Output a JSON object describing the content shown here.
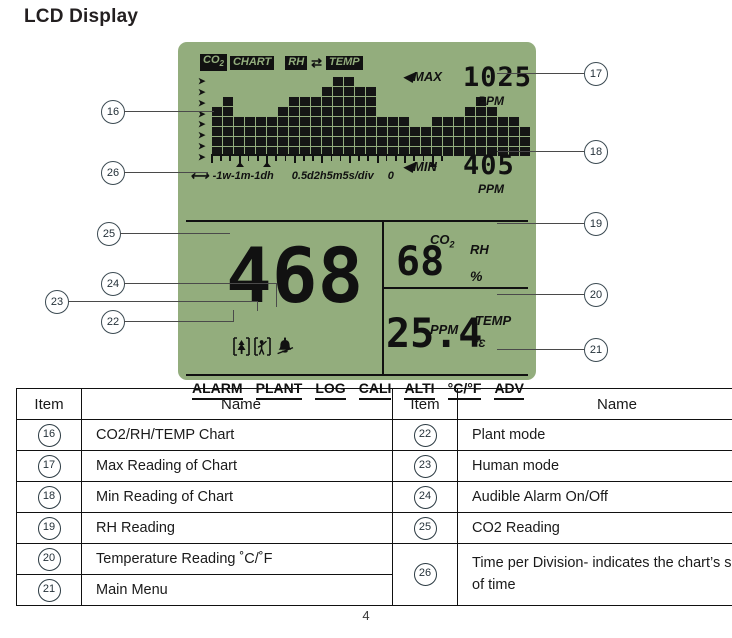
{
  "page_title": "LCD Display",
  "page_number": "4",
  "lcd": {
    "background_color": "#93ad7d",
    "segment_labels": {
      "co2": "CO2",
      "co2_main": "CO",
      "co2_sub": "2",
      "chart": "CHART",
      "rh": "RH",
      "swap_icon": "⇄",
      "temp": "TEMP"
    },
    "max": {
      "label": "MAX",
      "value": "1025",
      "unit": "PPM",
      "arrow": "←"
    },
    "min": {
      "label": "MIN",
      "value": "405",
      "unit": "PPM",
      "arrow": "←"
    },
    "time_axis": {
      "arrow_icon": "⟷",
      "left_labels": "-1w-1m-1dh",
      "right_labels": "0.5d2h5m5s/div",
      "zero": "0"
    },
    "main_reading": {
      "label_main": "CO",
      "label_sub": "2",
      "value": "468",
      "unit": "PPM"
    },
    "mode_icons": {
      "plant": "plant-mode-icon",
      "human": "human-mode-icon",
      "bell": "audible-alarm-icon"
    },
    "humidity": {
      "value": "68",
      "label": "RH",
      "unit": "%"
    },
    "temperature": {
      "value": "25.4",
      "label": "TEMP",
      "unit": "°Ɛ"
    },
    "menu_items": [
      "ALARM",
      "PLANT",
      "LOG",
      "CALI",
      "ALTI",
      "°C/°F",
      "ADV"
    ]
  },
  "chart_data": {
    "type": "bar",
    "title": "CO2/RH/TEMP Chart",
    "xlabel": "Time per division",
    "ylabel": "",
    "values": [
      5,
      6,
      4,
      4,
      4,
      4,
      5,
      6,
      6,
      6,
      7,
      8,
      8,
      7,
      7,
      4,
      4,
      4,
      3,
      3,
      4,
      4,
      4,
      5,
      6,
      5,
      4,
      4,
      3
    ],
    "ylim": [
      0,
      9
    ],
    "y_tick_count": 8,
    "axis_tick_count": 25,
    "marker_positions": [
      3,
      6,
      24
    ],
    "grid": false,
    "legend": "none"
  },
  "callouts": [
    {
      "id": "16",
      "target": "chart"
    },
    {
      "id": "17",
      "target": "max-reading"
    },
    {
      "id": "18",
      "target": "min-reading"
    },
    {
      "id": "19",
      "target": "rh-reading"
    },
    {
      "id": "20",
      "target": "temp-reading"
    },
    {
      "id": "21",
      "target": "main-menu"
    },
    {
      "id": "22",
      "target": "plant-mode"
    },
    {
      "id": "23",
      "target": "human-mode"
    },
    {
      "id": "24",
      "target": "audible-alarm"
    },
    {
      "id": "25",
      "target": "co2-reading"
    },
    {
      "id": "26",
      "target": "time-per-division"
    }
  ],
  "table": {
    "headers": [
      "Item",
      "Name",
      "Item",
      "Name"
    ],
    "rows": [
      {
        "l_item": "16",
        "l_name": "CO2/RH/TEMP Chart",
        "r_item": "22",
        "r_name": "Plant mode"
      },
      {
        "l_item": "17",
        "l_name": "Max Reading of Chart",
        "r_item": "23",
        "r_name": "Human mode"
      },
      {
        "l_item": "18",
        "l_name": "Min Reading of Chart",
        "r_item": "24",
        "r_name": "Audible Alarm On/Off"
      },
      {
        "l_item": "19",
        "l_name": "RH Reading",
        "r_item": "25",
        "r_name": "CO2 Reading"
      },
      {
        "l_item": "20",
        "l_name": "Temperature Reading ˚C/˚F",
        "r_item": "26",
        "r_name": "Time per Division- indicates the chart’s span of time"
      },
      {
        "l_item": "21",
        "l_name": "Main Menu",
        "r_item": "",
        "r_name": ""
      }
    ]
  }
}
